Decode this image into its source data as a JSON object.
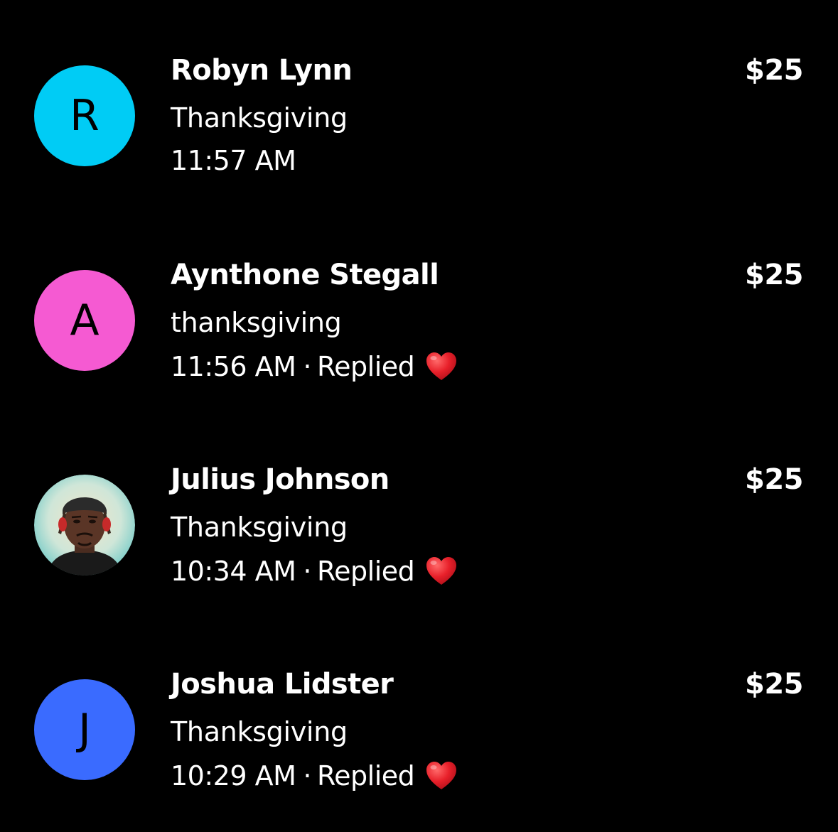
{
  "payments": [
    {
      "avatar_letter": "R",
      "avatar_color": "#00CCF5",
      "name": "Robyn Lynn",
      "note": "Thanksgiving",
      "time": "11:57 AM",
      "replied": false,
      "amount": "$25"
    },
    {
      "avatar_letter": "A",
      "avatar_color": "#F55AD2",
      "name": "Aynthone Stegall",
      "note": "thanksgiving",
      "time": "11:56 AM",
      "separator": "·",
      "replied_label": "Replied",
      "reaction_icon": "red-heart-icon",
      "replied": true,
      "amount": "$25"
    },
    {
      "avatar_icon": "profile-photo",
      "name": "Julius Johnson",
      "note": "Thanksgiving",
      "time": "10:34 AM",
      "separator": "·",
      "replied_label": "Replied",
      "reaction_icon": "red-heart-icon",
      "replied": true,
      "amount": "$25"
    },
    {
      "avatar_letter": "J",
      "avatar_color": "#3A6BFF",
      "name": "Joshua Lidster",
      "note": "Thanksgiving",
      "time": "10:29 AM",
      "separator": "·",
      "replied_label": "Replied",
      "reaction_icon": "red-heart-icon",
      "replied": true,
      "amount": "$25"
    }
  ],
  "colors": {
    "background": "#000000",
    "text": "#FFFFFF",
    "heart": "#E8202A"
  }
}
